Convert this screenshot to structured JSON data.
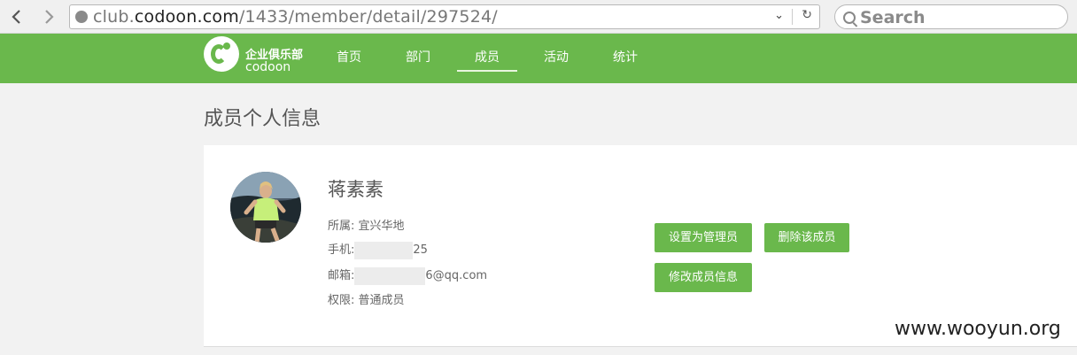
{
  "browser": {
    "back_icon": "chevron-left-icon",
    "forward_icon": "chevron-right-icon",
    "url_prefix": "club.",
    "url_domain": "codoon.com",
    "url_path": "/1433/member/detail/297524/",
    "dropdown_glyph": "⌄",
    "reload_glyph": "↻",
    "search_placeholder": "Search"
  },
  "header": {
    "logo_cn": "企业俱乐部",
    "logo_en": "codoon",
    "nav": [
      {
        "label": "首页"
      },
      {
        "label": "部门"
      },
      {
        "label": "成员",
        "active": true
      },
      {
        "label": "活动"
      },
      {
        "label": "统计"
      }
    ]
  },
  "page": {
    "title": "成员个人信息"
  },
  "member": {
    "name": "蒋素素",
    "affiliation_label": "所属:",
    "affiliation_value": "宜兴华地",
    "phone_label": "手机:",
    "phone_suffix": "25",
    "email_label": "邮箱:",
    "email_suffix": "6@qq.com",
    "permission_label": "权限:",
    "permission_value": "普通成员"
  },
  "actions": {
    "set_admin": "设置为管理员",
    "remove_member": "删除该成员",
    "edit_info": "修改成员信息"
  },
  "watermark": "www.wooyun.org",
  "colors": {
    "brand_green": "#6ab84c",
    "page_bg": "#f2f2f2"
  }
}
